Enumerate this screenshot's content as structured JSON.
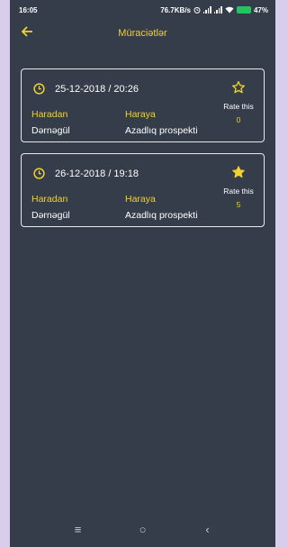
{
  "status_bar": {
    "time": "16:05",
    "net_speed": "76.7KB/s",
    "battery": "47%"
  },
  "app_bar": {
    "title": "Müraciətlər",
    "back_icon": "arrow-left-icon"
  },
  "requests": [
    {
      "datetime": "25-12-2018 / 20:26",
      "from_label": "Haradan",
      "to_label": "Haraya",
      "from": "Dərnəgül",
      "to": "Azadlıq prospekti",
      "rate_label": "Rate this",
      "rating": "0",
      "star": "outline"
    },
    {
      "datetime": "26-12-2018 / 19:18",
      "from_label": "Haradan",
      "to_label": "Haraya",
      "from": "Dərnəgül",
      "to": "Azadlıq prospekti",
      "rate_label": "Rate this",
      "rating": "5",
      "star": "filled"
    }
  ],
  "nav_bar": {
    "menu_icon": "≡",
    "home_icon": "○",
    "back_icon": "‹"
  },
  "colors": {
    "background": "#353c4a",
    "accent": "#f2d22e",
    "text": "#ffffff",
    "border": "#e7e9ee"
  }
}
